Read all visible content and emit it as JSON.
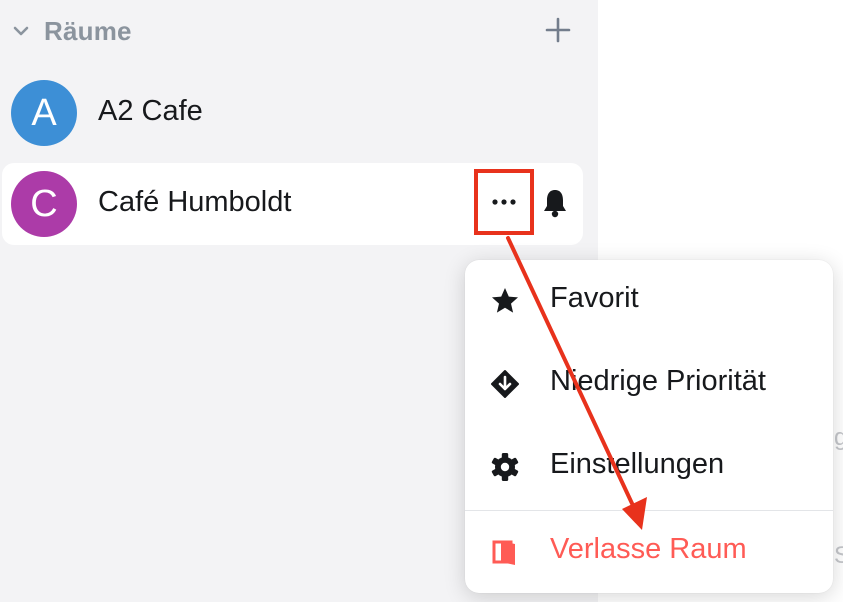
{
  "sidebar": {
    "section_title": "Räume",
    "rooms": [
      {
        "initial": "A",
        "name": "A2 Cafe",
        "color": "#3d8fd6"
      },
      {
        "initial": "C",
        "name": "Café Humboldt",
        "color": "#ac3ba8"
      }
    ]
  },
  "context_menu": {
    "items": [
      {
        "label": "Favorit",
        "icon": "star-icon"
      },
      {
        "label": "Niedrige Priorität",
        "icon": "low-priority-icon"
      },
      {
        "label": "Einstellungen",
        "icon": "gear-icon"
      },
      {
        "label": "Verlasse Raum",
        "icon": "leave-door-icon",
        "color": "#ff5b55"
      }
    ]
  },
  "annotation": {
    "color": "#e8321c"
  },
  "colors": {
    "sidebar_bg": "#f3f3f5",
    "section_title": "#8b949e",
    "text": "#17191c",
    "danger": "#ff5b55"
  }
}
